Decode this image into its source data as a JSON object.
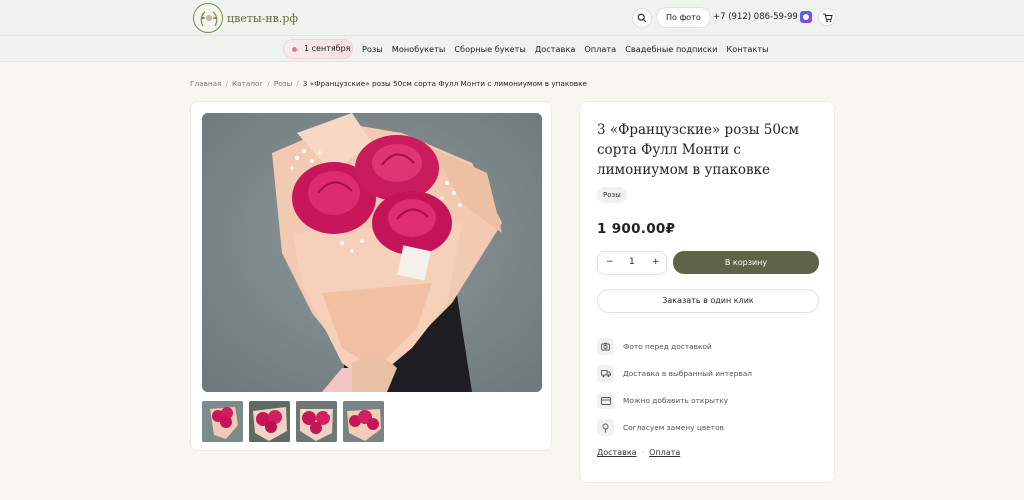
{
  "header": {
    "logo_text": "цветы-нв.рф",
    "photo_button": "По фото",
    "phone": "+7 (912) 086-59-99"
  },
  "nav": {
    "date_pill": "1 сентября",
    "links": [
      "Розы",
      "Монобукеты",
      "Сборные букеты",
      "Доставка",
      "Оплата",
      "Свадебные подписки",
      "Контакты"
    ]
  },
  "breadcrumbs": {
    "items": [
      "Главная",
      "Каталог",
      "Розы"
    ],
    "current": "3 «Французские» розы 50см сорта Фулл Монти с лимониумом в упаковке"
  },
  "product": {
    "title": "3 «Французские» розы 50см сорта Фулл Монти с лимониумом в упаковке",
    "tag": "Розы",
    "price": "1 900.00₽",
    "quantity": "1",
    "qty_minus": "−",
    "qty_plus": "+",
    "add_to_cart": "В корзину",
    "one_click": "Заказать в один клик",
    "features": [
      {
        "icon": "camera-icon",
        "text": "Фото перед доставкой"
      },
      {
        "icon": "truck-icon",
        "text": "Доставка в выбранный интервал"
      },
      {
        "icon": "card-icon",
        "text": "Можно добавить открытку"
      },
      {
        "icon": "flower-icon",
        "text": "Согласуем замену цветов"
      }
    ],
    "link_delivery": "Доставка",
    "link_payment": "Оплата",
    "link_separator": "·"
  },
  "colors": {
    "header_bg": "#eef3ee",
    "page_bg": "#f7f6f1",
    "accent_button": "#5c6646",
    "rose": "#d2185f"
  }
}
